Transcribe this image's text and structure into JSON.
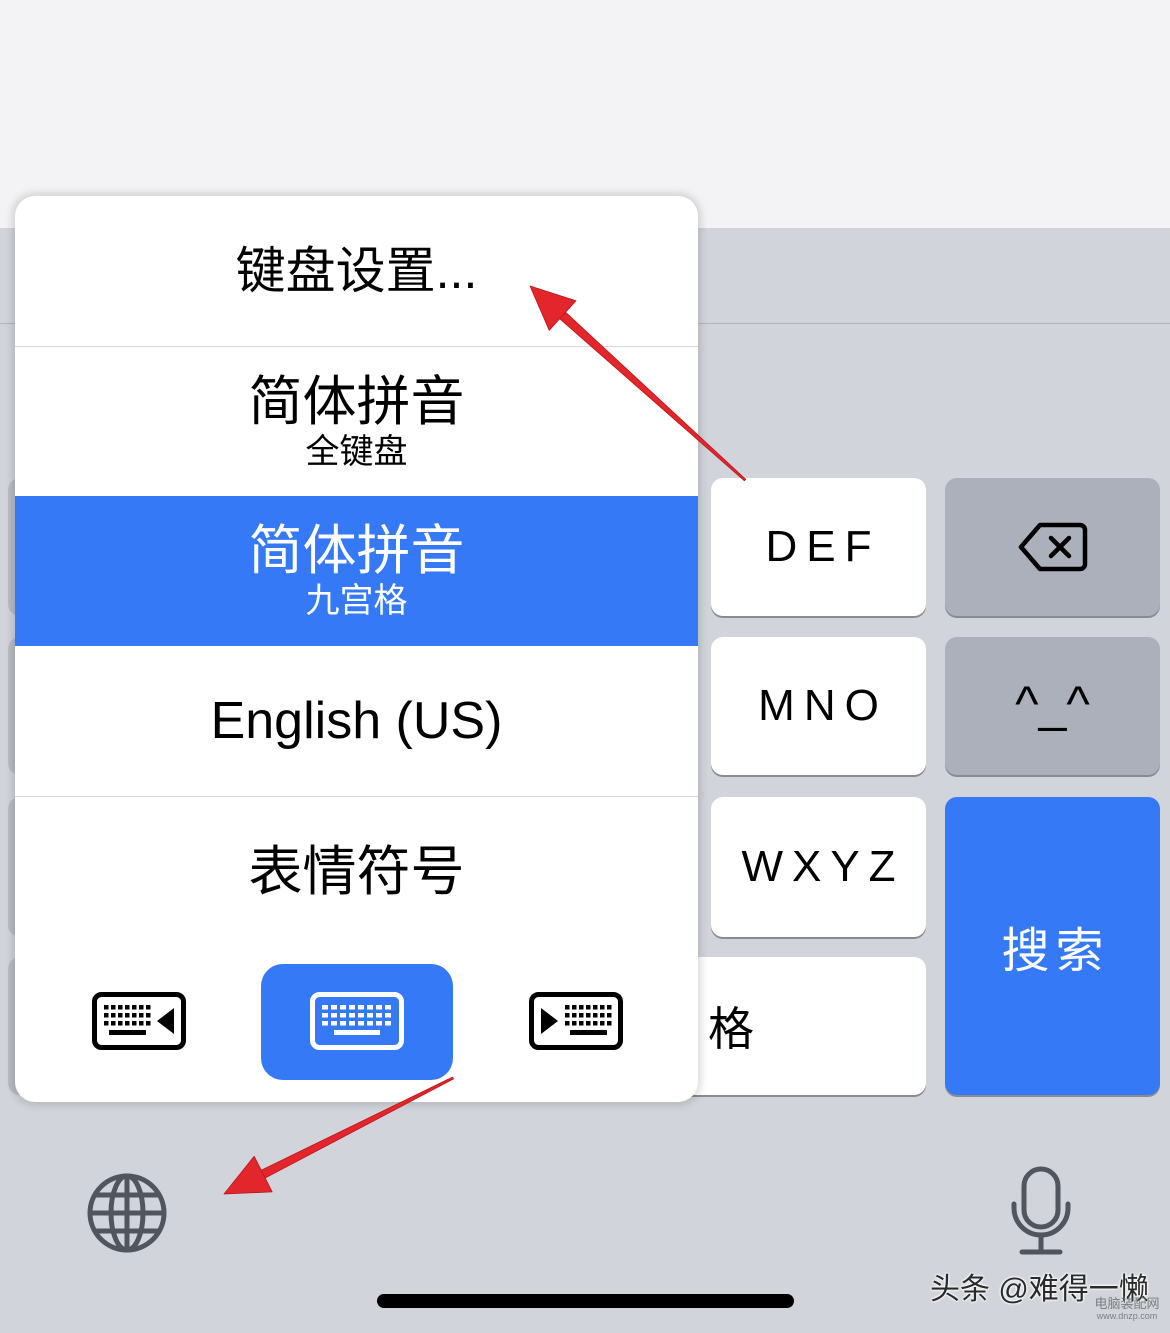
{
  "input_switcher": {
    "settings_label": "键盘设置...",
    "items": [
      {
        "title": "简体拼音",
        "subtitle": "全键盘",
        "selected": false
      },
      {
        "title": "简体拼音",
        "subtitle": "九宫格",
        "selected": true
      },
      {
        "title": "English (US)",
        "selected": false
      },
      {
        "title": "表情符号",
        "selected": false
      }
    ],
    "layout_options": [
      {
        "icon": "keyboard-left-icon",
        "selected": false
      },
      {
        "icon": "keyboard-full-icon",
        "selected": true
      },
      {
        "icon": "keyboard-right-icon",
        "selected": false
      }
    ]
  },
  "keyboard": {
    "keys": {
      "def": "DEF",
      "mno": "MNO",
      "wxyz": "WXYZ",
      "kaomoji": "^_^",
      "space_visible": "格",
      "search": "搜索"
    },
    "icons": {
      "delete": "delete-left-icon",
      "globe": "globe-icon",
      "dictation": "microphone-icon"
    }
  },
  "watermark": {
    "author": "头条 @难得一懒",
    "site_name": "电脑装配网",
    "site_url": "www.dnzp.com"
  },
  "colors": {
    "accent": "#3579f6",
    "keyboard_bg": "#d1d4da",
    "function_key": "#abb0bb",
    "key": "#ffffff",
    "annotation": "#e3262c"
  }
}
